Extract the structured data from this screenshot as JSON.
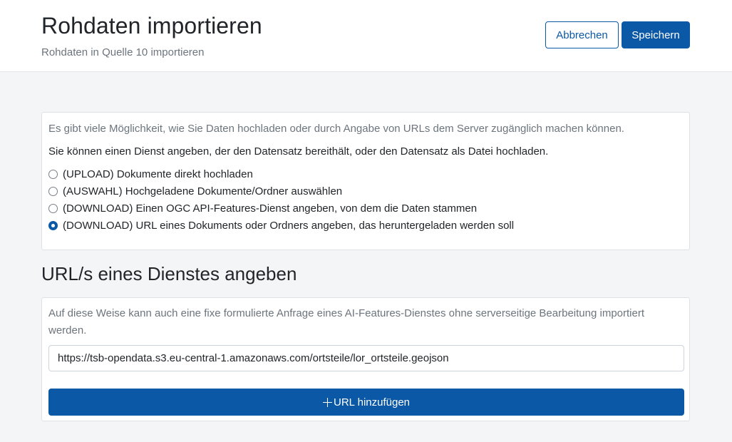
{
  "header": {
    "title": "Rohdaten importieren",
    "subtitle": "Rohdaten in Quelle 10 importieren",
    "cancel_label": "Abbrechen",
    "save_label": "Speichern"
  },
  "options": {
    "intro_muted": "Es gibt viele Möglichkeit, wie Sie Daten hochladen oder durch Angabe von URLs dem Server zugänglich machen können.",
    "intro_text": "Sie können einen Dienst angeben, der den Datensatz bereithält, oder den Datensatz als Datei hochladen.",
    "items": [
      {
        "label": "(UPLOAD) Dokumente direkt hochladen",
        "checked": false
      },
      {
        "label": "(AUSWAHL) Hochgeladene Dokumente/Ordner auswählen",
        "checked": false
      },
      {
        "label": "(DOWNLOAD) Einen OGC API-Features-Dienst angeben, von dem die Daten stammen",
        "checked": false
      },
      {
        "label": "(DOWNLOAD) URL eines Dokuments oder Ordners angeben, das heruntergeladen werden soll",
        "checked": true
      }
    ]
  },
  "url_section": {
    "title": "URL/s eines Dienstes angeben",
    "description": "Auf diese Weise kann auch eine fixe formulierte Anfrage eines AI-Features-Dienstes ohne serverseitige Bearbeitung importiert werden.",
    "url_value": "https://tsb-opendata.s3.eu-central-1.amazonaws.com/ortsteile/lor_ortsteile.geojson",
    "add_button_label": "URL hinzufügen"
  },
  "colors": {
    "primary": "#0a58a6",
    "muted_text": "#6c757d",
    "page_background": "#f4f5f7"
  }
}
